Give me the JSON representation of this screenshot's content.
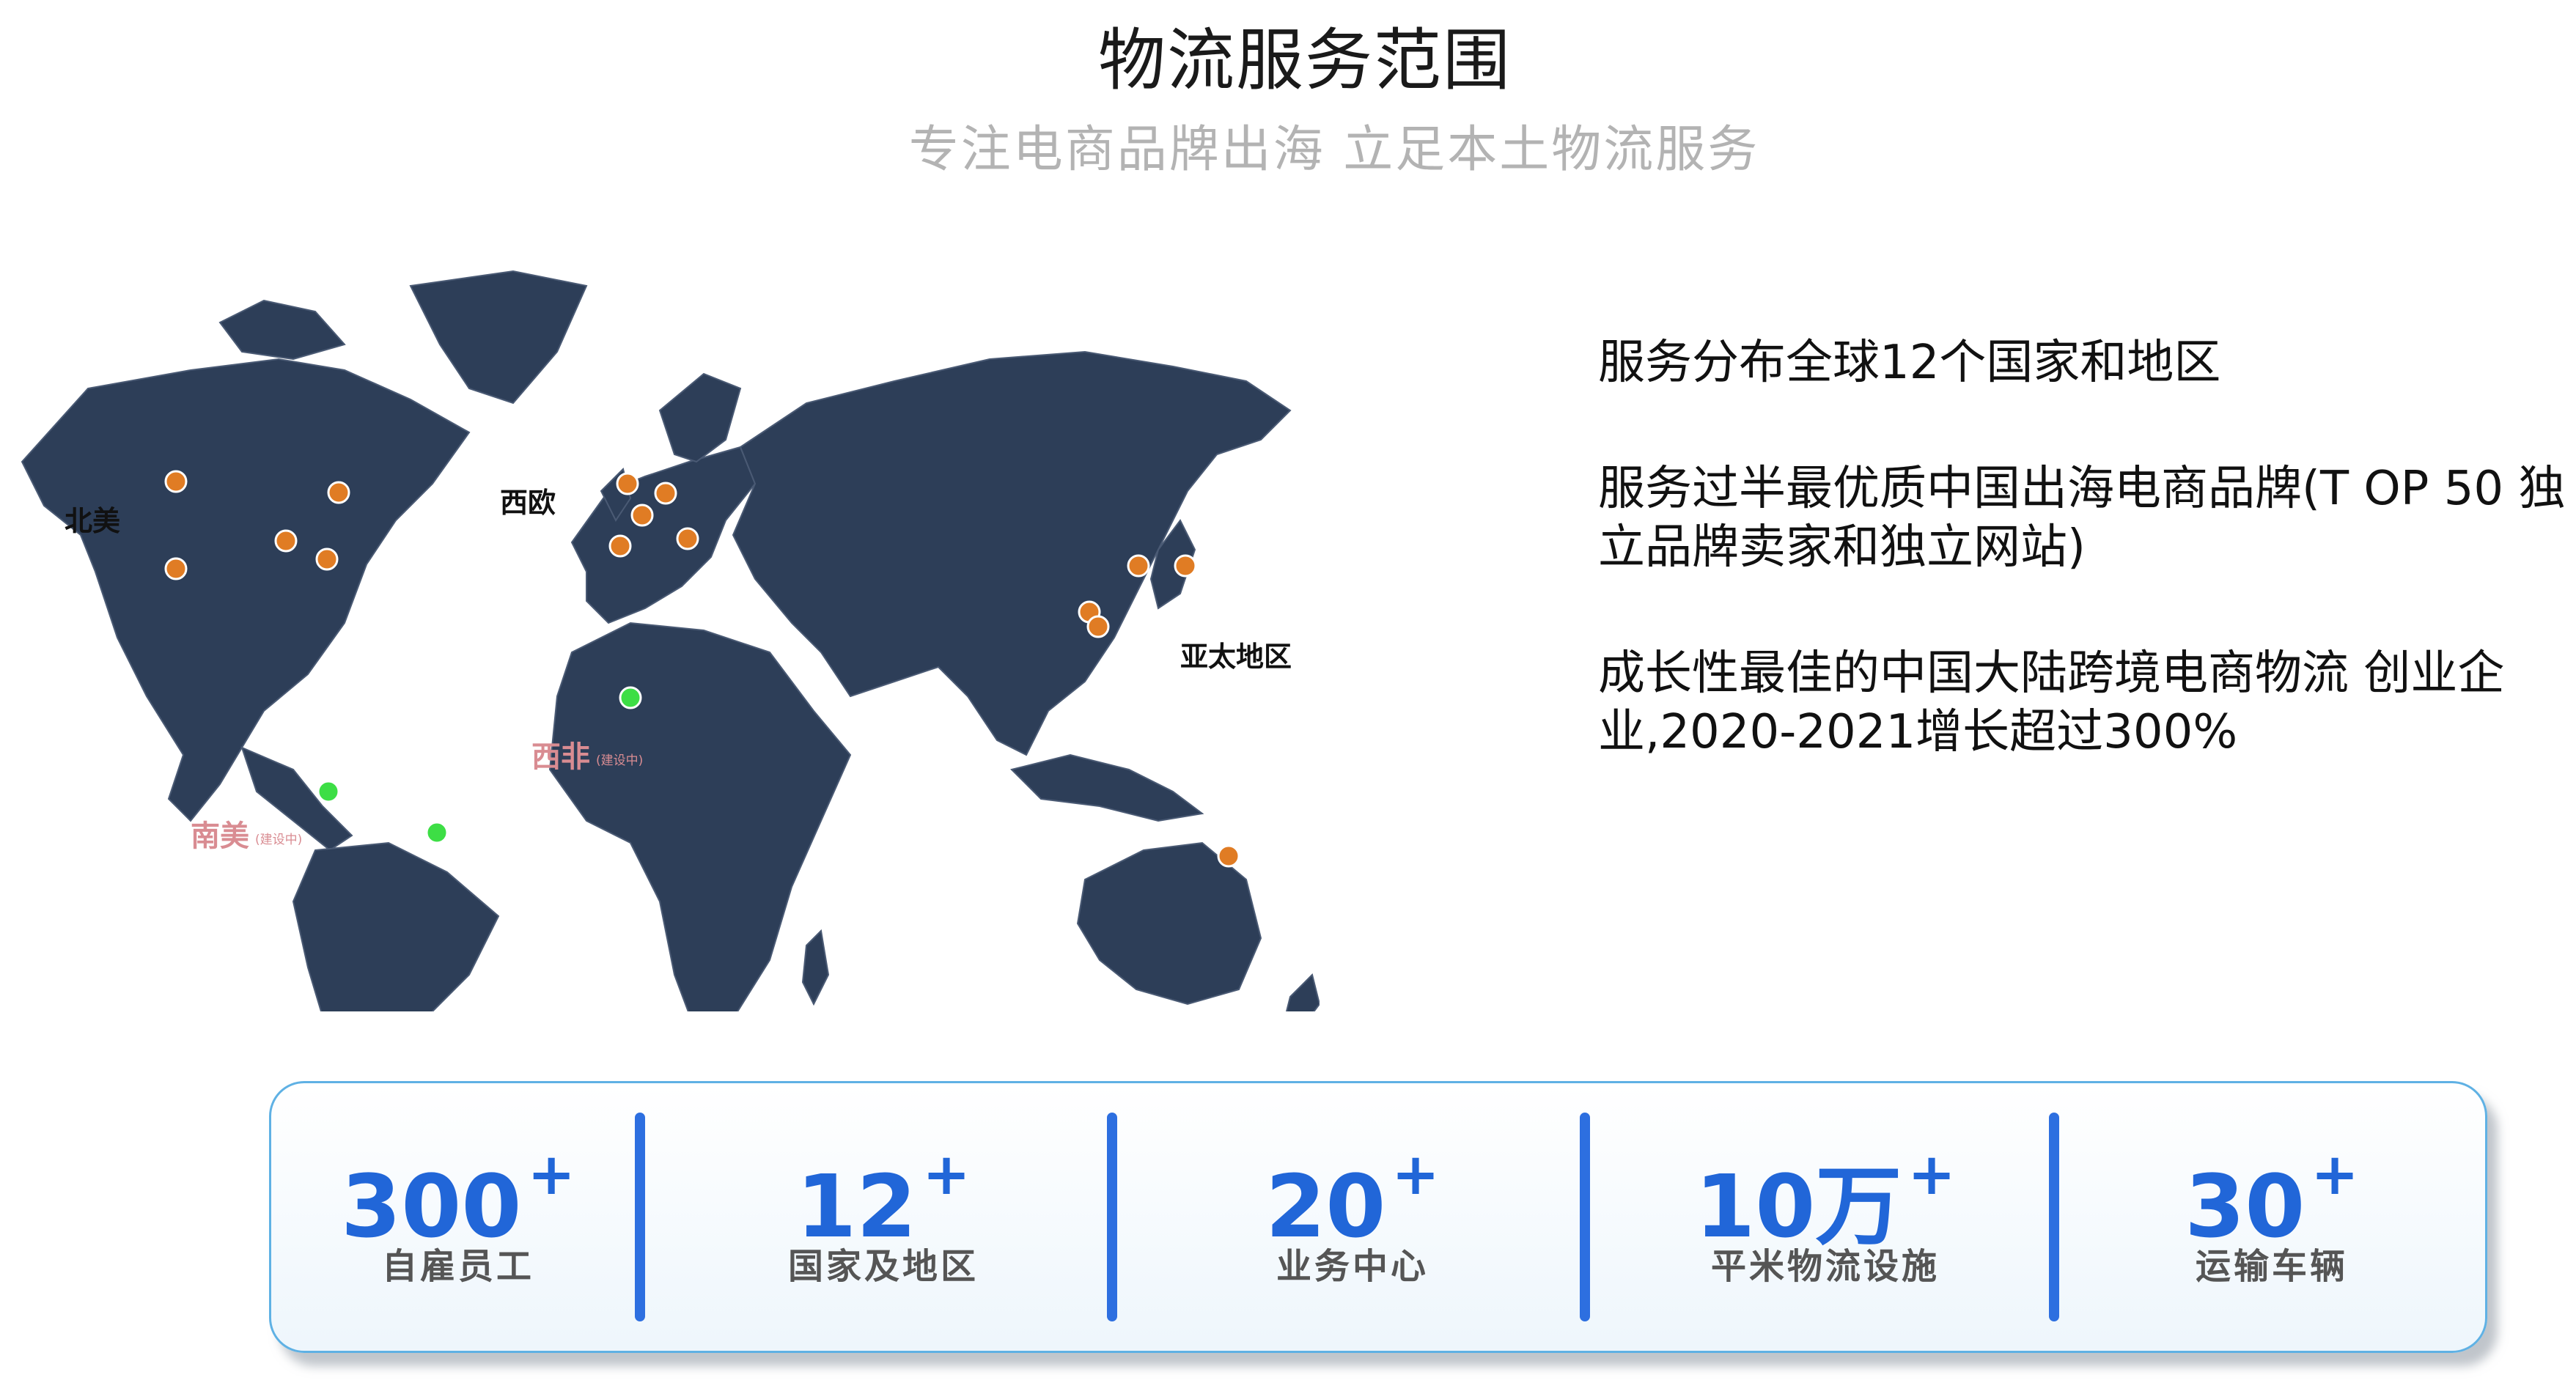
{
  "header": {
    "title": "物流服务范围",
    "subtitle": "专注电商品牌出海  立足本土物流服务"
  },
  "map": {
    "labels": {
      "north_america": "北美",
      "west_europe": "西欧",
      "asia_pacific": "亚太地区",
      "west_africa": "西非",
      "west_africa_note": "(建设中)",
      "south_america": "南美",
      "south_america_note": "(建设中)"
    },
    "colors": {
      "land": "#2d3e58",
      "active_marker": "#e07c24",
      "building_marker": "#3dde45"
    }
  },
  "facts": [
    "服务分布全球12个国家和地区",
    "服务过半最优质中国出海电商品牌(T OP 50 独立品牌卖家和独立网站)",
    "成长性最佳的中国大陆跨境电商物流 创业企业,2020-2021增长超过300%"
  ],
  "stats": [
    {
      "value": "300",
      "suffix": "+",
      "label": "自雇员工"
    },
    {
      "value": "12",
      "suffix": "+",
      "label": "国家及地区"
    },
    {
      "value": "20",
      "suffix": "+",
      "label": "业务中心"
    },
    {
      "value": "10万",
      "suffix": "+",
      "label": "平米物流设施"
    },
    {
      "value": "30",
      "suffix": "+",
      "label": "运输车辆"
    }
  ]
}
